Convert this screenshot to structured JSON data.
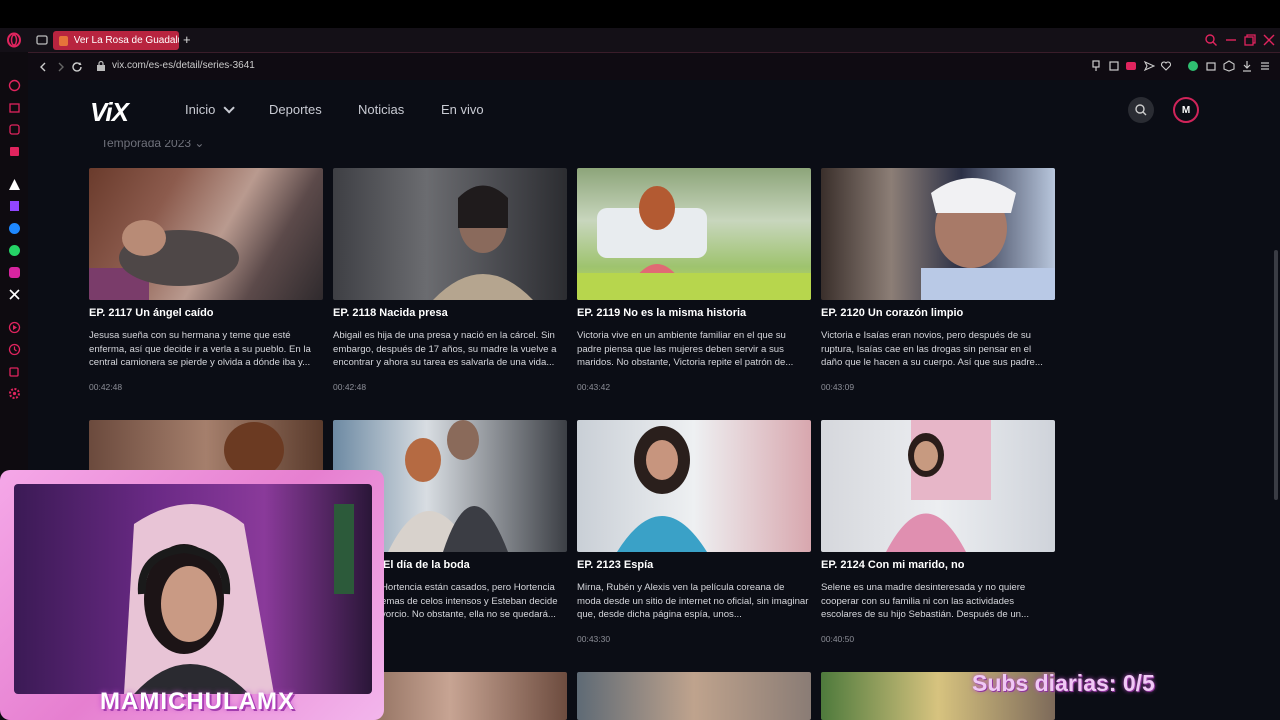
{
  "browser": {
    "tab_title": "Ver La Rosa de Guadalupe",
    "new_tab": "+",
    "url": "vix.com/es-es/detail/series-3641"
  },
  "header": {
    "logo": "ViX",
    "nav": [
      "Inicio",
      "Deportes",
      "Noticias",
      "En vivo"
    ],
    "avatar": "M"
  },
  "season_label": "Temporada 2023",
  "episodes": [
    {
      "title": "EP. 2117  Un ángel caído",
      "desc": "Jesusa sueña con su hermana y teme que esté enferma, así que decide ir a verla a su pueblo. En la central camionera se pierde y olvida a dónde iba y...",
      "duration": "00:42:48"
    },
    {
      "title": "EP. 2118  Nacida presa",
      "desc": "Abigail es hija de una presa y nació en la cárcel. Sin embargo, después de 17 años, su madre la vuelve a encontrar y ahora su tarea es salvarla de una vida...",
      "duration": "00:42:48"
    },
    {
      "title": "EP. 2119  No es la misma historia",
      "desc": "Victoria vive en un ambiente familiar en el que su padre piensa que las mujeres deben servir a sus maridos. No obstante, Victoria repite el patrón de...",
      "duration": "00:43:42"
    },
    {
      "title": "EP. 2120  Un corazón limpio",
      "desc": "Victoria e Isaías eran novios, pero después de su ruptura, Isaías cae en las drogas sin pensar en el daño que le hacen a su cuerpo. Así que sus padre...",
      "duration": "00:43:09"
    },
    {
      "title": "El día de la boda",
      "desc": "Hortencia están casados, pero Hortencia emas de celos intensos y Esteban decide vorcio. No obstante, ella no se quedará...",
      "duration": ""
    },
    {
      "title": "EP. 2123  Espía",
      "desc": "Mirna, Rubén y Alexis ven la película coreana de moda desde un sitio de internet no oficial, sin imaginar que, desde dicha página espía, unos...",
      "duration": "00:43:30"
    },
    {
      "title": "EP. 2124  Con mi marido, no",
      "desc": "Selene es una madre desinteresada y no quiere cooperar con su familia ni con las actividades escolares de su hijo Sebastián. Después de un...",
      "duration": "00:40:50"
    }
  ],
  "overlay": {
    "streamer_name": "MAMICHULAMX",
    "subs_text": "Subs diarias: 0/5"
  }
}
